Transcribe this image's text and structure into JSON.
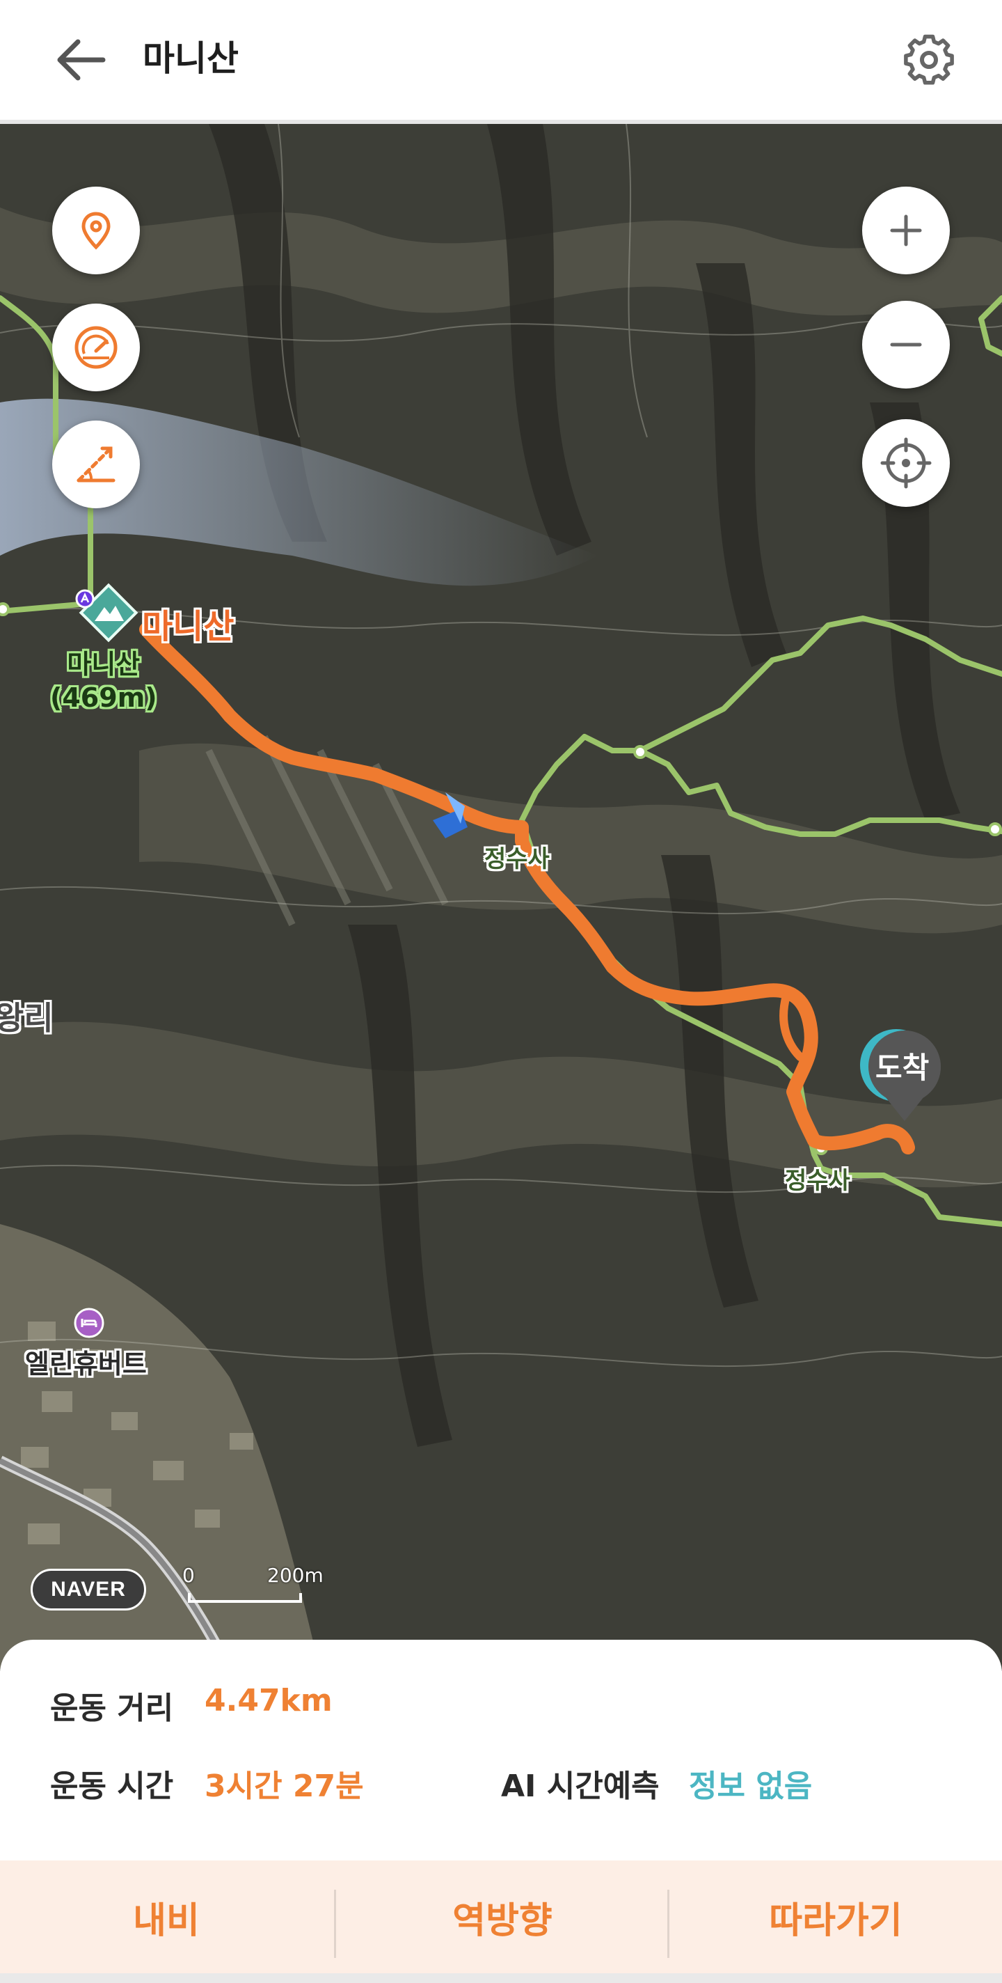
{
  "header": {
    "title": "마니산",
    "back_icon": "arrow-left-icon",
    "settings_icon": "gear-icon"
  },
  "map": {
    "peak_name": "마니산",
    "peak_label_name": "마니산",
    "peak_label_altitude": "(469m)",
    "place_jeongsusa_top": "정수사",
    "place_jeongsusa": "정수사",
    "village_fragment": "왕리",
    "lodging_name": "엘린휴버트",
    "arrival_marker": "도착",
    "provider_logo": "NAVER",
    "scale_zero": "0",
    "scale_distance": "200m",
    "controls": {
      "left": [
        "map-pin-icon",
        "speedometer-icon",
        "elevation-slope-icon"
      ],
      "right": [
        "zoom-in-icon",
        "zoom-out-icon",
        "locate-me-icon"
      ]
    },
    "route_color": "#ef7b30",
    "trail_color": "#8fb55a"
  },
  "info": {
    "distance_label": "운동 거리",
    "distance_value": "4.47km",
    "time_label": "운동 시간",
    "time_value": "3시간 27분",
    "ai_label": "AI 시간예측",
    "ai_value": "정보 없음"
  },
  "actions": {
    "navigate": "내비",
    "reverse": "역방향",
    "follow": "따라가기"
  },
  "colors": {
    "accent": "#ef8133",
    "teal": "#4cb6c3",
    "action_bg": "#fdeee5"
  }
}
